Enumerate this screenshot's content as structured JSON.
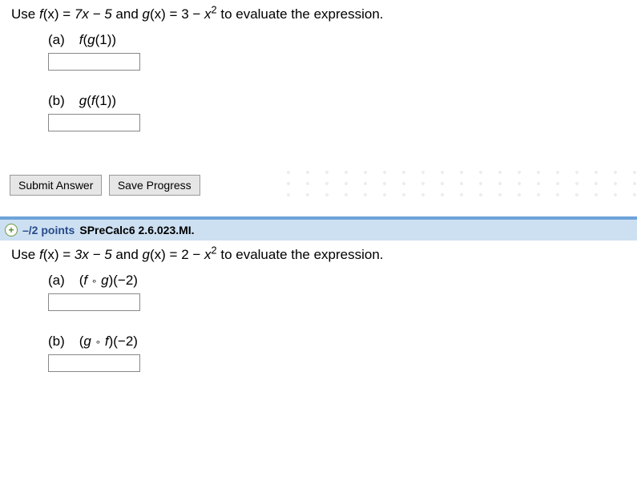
{
  "q1": {
    "prompt_pre": "Use  ",
    "f_name": "f",
    "f_of": "(x)",
    "eq1": " = ",
    "f_body": "7x − 5",
    "and": "  and  ",
    "g_name": "g",
    "g_of": "(x)",
    "eq2": " = ",
    "g_body_a": "3 − ",
    "g_body_var": "x",
    "g_body_exp": "2",
    "prompt_post": "  to evaluate the expression.",
    "parts": {
      "a": {
        "label": "(a)",
        "expr_outer": "f",
        "expr_inner": "g",
        "arg": "(1))"
      },
      "b": {
        "label": "(b)",
        "expr_outer": "g",
        "expr_inner": "f",
        "arg": "(1))"
      }
    }
  },
  "buttons": {
    "submit": "Submit Answer",
    "save": "Save Progress"
  },
  "header2": {
    "points": "–/2 points",
    "ref": "SPreCalc6 2.6.023.MI."
  },
  "q2": {
    "prompt_pre": "Use  ",
    "f_name": "f",
    "f_of": "(x)",
    "eq1": " = ",
    "f_body": "3x − 5",
    "and": "  and  ",
    "g_name": "g",
    "g_of": "(x)",
    "eq2": " = ",
    "g_body_a": "2 − ",
    "g_body_var": "x",
    "g_body_exp": "2",
    "prompt_post": "  to evaluate the expression.",
    "parts": {
      "a": {
        "label": "(a)",
        "outer": "f",
        "inner": "g",
        "arg": "(−2)",
        "open": "(",
        "close": ")"
      },
      "b": {
        "label": "(b)",
        "outer": "g",
        "inner": "f",
        "arg": "(−2)",
        "open": "(",
        "close": ")"
      }
    }
  },
  "input_values": {
    "q1a": "",
    "q1b": "",
    "q2a": "",
    "q2b": ""
  }
}
